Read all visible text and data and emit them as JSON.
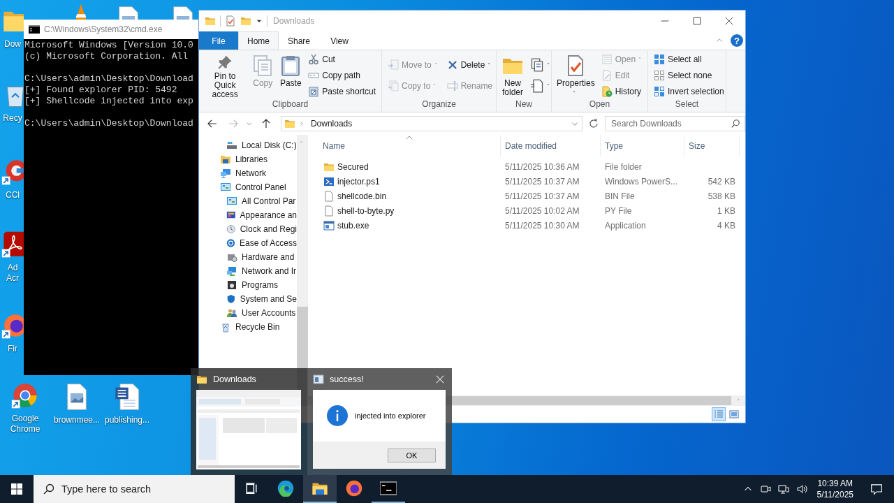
{
  "desktop": {
    "icons": [
      {
        "kind": "folder",
        "label": "Dow",
        "shortcut": false
      },
      {
        "kind": "cone"
      },
      {
        "kind": "image-doc"
      },
      {
        "kind": "image-doc"
      },
      {
        "kind": "recycle",
        "label": "Recy",
        "shortcut": false
      },
      {
        "kind": "cleaner",
        "label": "CCl",
        "shortcut": true
      },
      {
        "kind": "acrobat",
        "label": "Ad Acr",
        "shortcut": true
      },
      {
        "kind": "firefox",
        "label": "Fir",
        "shortcut": true
      },
      {
        "kind": "chrome",
        "label": "Google Chrome",
        "shortcut": true
      },
      {
        "kind": "image-doc",
        "label": "brownmee...",
        "shortcut": false
      },
      {
        "kind": "word-doc",
        "label": "publishing...",
        "shortcut": false
      }
    ]
  },
  "cmd_window": {
    "title": "C:\\Windows\\System32\\cmd.exe",
    "blocks": [
      [
        "Microsoft Windows [Version 10.0",
        "(c) Microsoft Corporation. All"
      ],
      [
        "C:\\Users\\admin\\Desktop\\Download",
        "[+] Found explorer PID: 5492",
        "[+] Shellcode injected into exp"
      ],
      [
        "C:\\Users\\admin\\Desktop\\Download"
      ]
    ]
  },
  "explorer": {
    "title": "Downloads",
    "help": "?",
    "tabs": [
      {
        "label": "File",
        "kind": "menu",
        "selected": false
      },
      {
        "label": "Home",
        "kind": "tab",
        "selected": true
      },
      {
        "label": "Share",
        "kind": "tab",
        "selected": false
      },
      {
        "label": "View",
        "kind": "tab",
        "selected": false
      }
    ],
    "ribbon_groups": [
      {
        "label": "Clipboard",
        "columns": [
          {
            "kind": "large",
            "commands": [
              {
                "label": "Pin to Quick access",
                "kind": "pin",
                "disabled": false,
                "dropdown": false
              }
            ]
          },
          {
            "kind": "large",
            "commands": [
              {
                "label": "Copy",
                "kind": "copy",
                "disabled": true,
                "dropdown": false
              }
            ]
          },
          {
            "kind": "large",
            "commands": [
              {
                "label": "Paste",
                "kind": "paste",
                "disabled": false,
                "dropdown": false
              }
            ]
          },
          {
            "kind": "small",
            "commands": [
              {
                "label": "Cut",
                "kind": "cut",
                "disabled": false,
                "dropdown": false
              },
              {
                "label": "Copy path",
                "kind": "copy-path",
                "disabled": false,
                "dropdown": false
              },
              {
                "label": "Paste shortcut",
                "kind": "paste-shortcut",
                "disabled": false,
                "dropdown": false
              }
            ]
          }
        ]
      },
      {
        "label": "Organize",
        "columns": [
          {
            "kind": "small",
            "commands": [
              {
                "label": "Move to",
                "kind": "move-to",
                "disabled": true,
                "dropdown": true
              },
              {
                "label": "Copy to",
                "kind": "copy-to",
                "disabled": true,
                "dropdown": true
              }
            ]
          },
          {
            "kind": "small",
            "commands": [
              {
                "label": "Delete",
                "kind": "delete",
                "disabled": false,
                "dropdown": true
              },
              {
                "label": "Rename",
                "kind": "rename",
                "disabled": true,
                "dropdown": false
              }
            ]
          }
        ]
      },
      {
        "label": "New",
        "columns": [
          {
            "kind": "large",
            "commands": [
              {
                "label": "New folder",
                "kind": "new-folder",
                "disabled": false,
                "dropdown": false
              }
            ]
          },
          {
            "kind": "small",
            "commands": [
              {
                "kind": "new-item",
                "disabled": false,
                "dropdown": true
              },
              {
                "kind": "easy-access",
                "disabled": false,
                "dropdown": true
              }
            ]
          }
        ]
      },
      {
        "label": "Open",
        "columns": [
          {
            "kind": "large",
            "commands": [
              {
                "label": "Properties",
                "kind": "properties",
                "disabled": false,
                "dropdown": true
              }
            ]
          },
          {
            "kind": "small",
            "commands": [
              {
                "label": "Open",
                "kind": "open",
                "disabled": true,
                "dropdown": true
              },
              {
                "label": "Edit",
                "kind": "edit",
                "disabled": true,
                "dropdown": false
              },
              {
                "label": "History",
                "kind": "history",
                "disabled": false,
                "dropdown": false
              }
            ]
          }
        ]
      },
      {
        "label": "Select",
        "columns": [
          {
            "kind": "small",
            "commands": [
              {
                "label": "Select all",
                "kind": "select-all",
                "disabled": false,
                "dropdown": false
              },
              {
                "label": "Select none",
                "kind": "select-none",
                "disabled": false,
                "dropdown": false
              },
              {
                "label": "Invert selection",
                "kind": "invert",
                "disabled": false,
                "dropdown": false
              }
            ]
          }
        ]
      }
    ],
    "address": {
      "path": "Downloads",
      "search_placeholder": "Search Downloads"
    },
    "nav_items": [
      {
        "label": "Local Disk (C:)",
        "kind": "drive"
      },
      {
        "label": "Libraries",
        "kind": "library"
      },
      {
        "label": "Network",
        "kind": "network"
      },
      {
        "label": "Control Panel",
        "kind": "control-panel",
        "children": [
          {
            "label": "All Control Par",
            "kind": "control-panel"
          },
          {
            "label": "Appearance an",
            "kind": "appearance"
          },
          {
            "label": "Clock and Regi",
            "kind": "clock"
          },
          {
            "label": "Ease of Access",
            "kind": "ease"
          },
          {
            "label": "Hardware and",
            "kind": "hardware"
          },
          {
            "label": "Network and Ir",
            "kind": "network-internet"
          },
          {
            "label": "Programs",
            "kind": "programs"
          },
          {
            "label": "System and Se",
            "kind": "system"
          },
          {
            "label": "User Accounts",
            "kind": "users"
          }
        ]
      },
      {
        "label": "Recycle Bin",
        "kind": "recycle"
      }
    ],
    "columns": [
      {
        "label": "Name",
        "sorted": true
      },
      {
        "label": "Date modified",
        "sorted": false
      },
      {
        "label": "Type",
        "sorted": false
      },
      {
        "label": "Size",
        "sorted": false
      }
    ],
    "files": [
      {
        "name": "Secured",
        "kind": "folder",
        "date": "5/11/2025 10:36 AM",
        "type": "File folder"
      },
      {
        "name": "injector.ps1",
        "kind": "powershell",
        "date": "5/11/2025 10:37 AM",
        "type": "Windows PowerS...",
        "size": "542 KB"
      },
      {
        "name": "shellcode.bin",
        "kind": "file",
        "date": "5/11/2025 10:37 AM",
        "type": "BIN File",
        "size": "538 KB"
      },
      {
        "name": "shell-to-byte.py",
        "kind": "file",
        "date": "5/11/2025 10:02 AM",
        "type": "PY File",
        "size": "1 KB"
      },
      {
        "name": "stub.exe",
        "kind": "exe",
        "date": "5/11/2025 10:30 AM",
        "type": "Application",
        "size": "4 KB"
      }
    ],
    "views": [
      {
        "kind": "details",
        "selected": true
      },
      {
        "kind": "large-icons",
        "selected": false
      }
    ]
  },
  "taskbar_preview": {
    "thumbnail": {
      "title": "Downloads"
    },
    "dialog": {
      "title": "success!",
      "message": "injected into explorer",
      "button": "OK"
    }
  },
  "taskbar": {
    "search_placeholder": "Type here to search",
    "apps": [
      {
        "kind": "task-view",
        "active": false,
        "running": false
      },
      {
        "kind": "edge",
        "active": false,
        "running": false
      },
      {
        "kind": "explorer",
        "active": true,
        "running": true
      },
      {
        "kind": "firefox",
        "active": false,
        "running": false
      },
      {
        "kind": "terminal",
        "active": false,
        "running": true
      }
    ],
    "time": "10:39 AM",
    "date": "5/11/2025"
  }
}
